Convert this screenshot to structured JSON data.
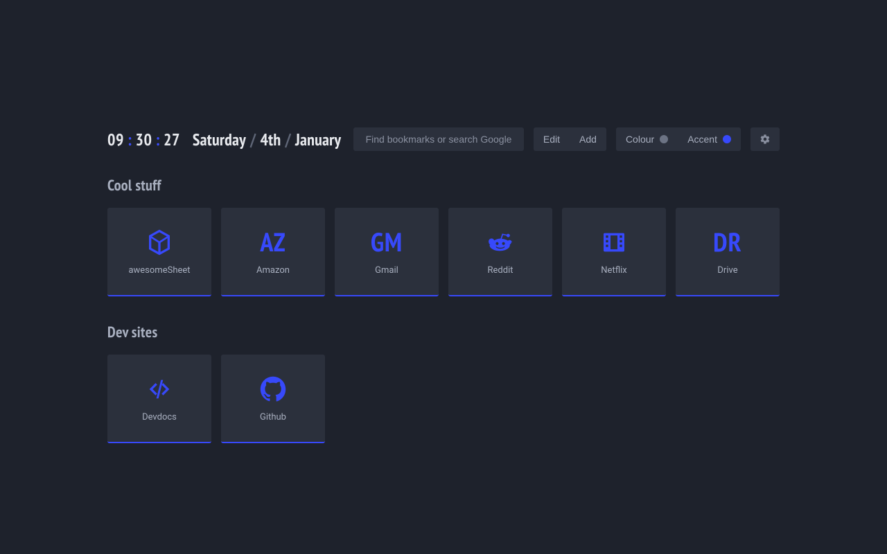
{
  "clock": {
    "hours": "09",
    "minutes": "30",
    "seconds": "27",
    "separator": ":"
  },
  "date": {
    "day_name": "Saturday",
    "day_num": "4th",
    "month": "January",
    "separator": "/"
  },
  "search": {
    "placeholder": "Find bookmarks or search Google"
  },
  "toolbar": {
    "edit_label": "Edit",
    "add_label": "Add",
    "colour_label": "Colour",
    "accent_label": "Accent"
  },
  "colors": {
    "accent": "#3749fb",
    "swatch_neutral": "#6c7384"
  },
  "groups": [
    {
      "title": "Cool stuff",
      "tiles": [
        {
          "label": "awesomeSheet",
          "icon": "d20-icon"
        },
        {
          "label": "Amazon",
          "letters": "AZ"
        },
        {
          "label": "Gmail",
          "letters": "GM"
        },
        {
          "label": "Reddit",
          "icon": "reddit-icon"
        },
        {
          "label": "Netflix",
          "icon": "film-icon"
        },
        {
          "label": "Drive",
          "letters": "DR"
        }
      ]
    },
    {
      "title": "Dev sites",
      "tiles": [
        {
          "label": "Devdocs",
          "icon": "code-icon"
        },
        {
          "label": "Github",
          "icon": "github-icon"
        }
      ]
    }
  ]
}
